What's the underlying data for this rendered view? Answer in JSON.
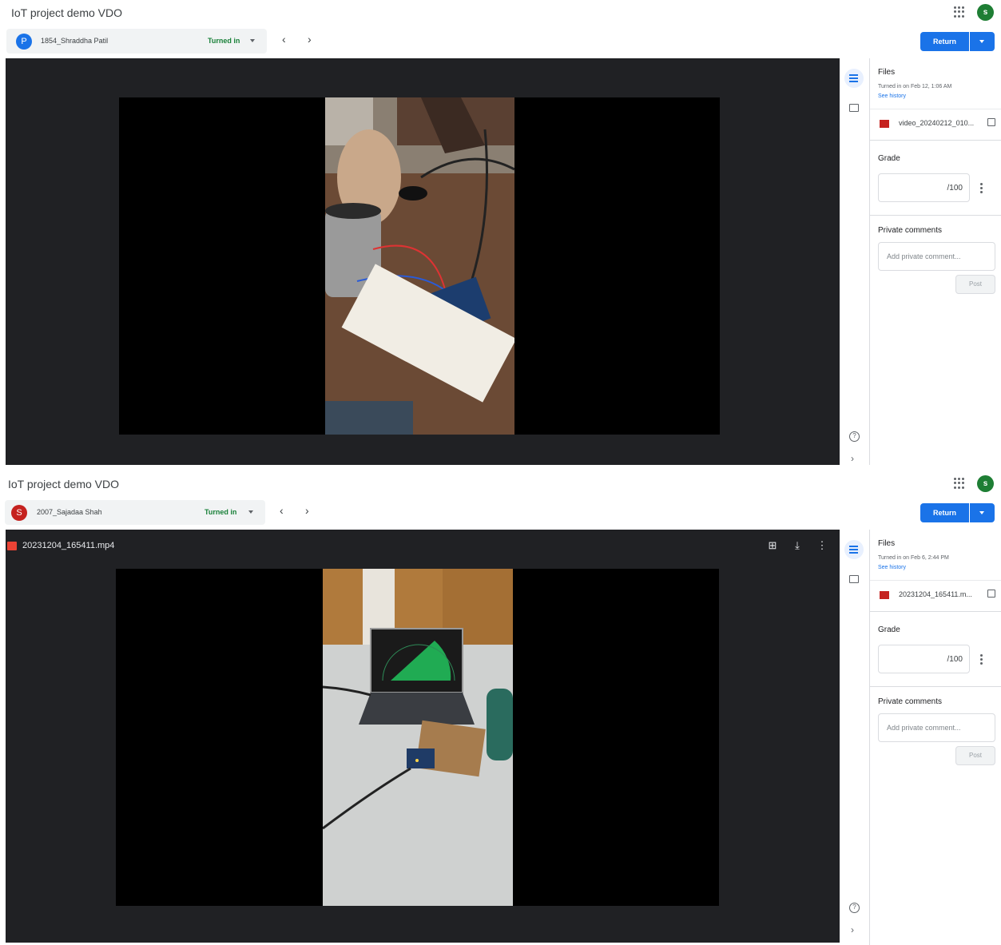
{
  "panels": [
    {
      "app": {
        "title": "IoT project demo VDO"
      },
      "user": {
        "initial": "s"
      },
      "student": {
        "initial": "P",
        "name": "1854_Shraddha Patil",
        "status": "Turned in",
        "avatar_color": "#1a73e8"
      },
      "actions": {
        "return_label": "Return",
        "prev_icon": "‹",
        "next_icon": "›"
      },
      "viewer": {
        "file_name": ""
      },
      "side": {
        "files_title": "Files",
        "turned_in": "Turned in on Feb 12, 1:06 AM",
        "see_history": "See history",
        "file_name": "video_20240212_010...",
        "grade_title": "Grade",
        "grade_max": "/100",
        "private_title": "Private comments",
        "comment_placeholder": "Add private comment...",
        "post_label": "Post"
      }
    },
    {
      "app": {
        "title": "IoT project demo VDO"
      },
      "user": {
        "initial": "s"
      },
      "student": {
        "initial": "S",
        "name": "2007_Sajadaa Shah",
        "status": "Turned in",
        "avatar_color": "#c5221f"
      },
      "actions": {
        "return_label": "Return",
        "prev_icon": "‹",
        "next_icon": "›"
      },
      "viewer": {
        "file_name": "20231204_165411.mp4"
      },
      "side": {
        "files_title": "Files",
        "turned_in": "Turned in on Feb 6, 2:44 PM",
        "see_history": "See history",
        "file_name": "20231204_165411.m...",
        "grade_title": "Grade",
        "grade_max": "/100",
        "private_title": "Private comments",
        "comment_placeholder": "Add private comment...",
        "post_label": "Post"
      }
    }
  ],
  "colors": {
    "accent": "#1a73e8",
    "status_green": "#188038",
    "user_avatar": "#1e7e34"
  }
}
